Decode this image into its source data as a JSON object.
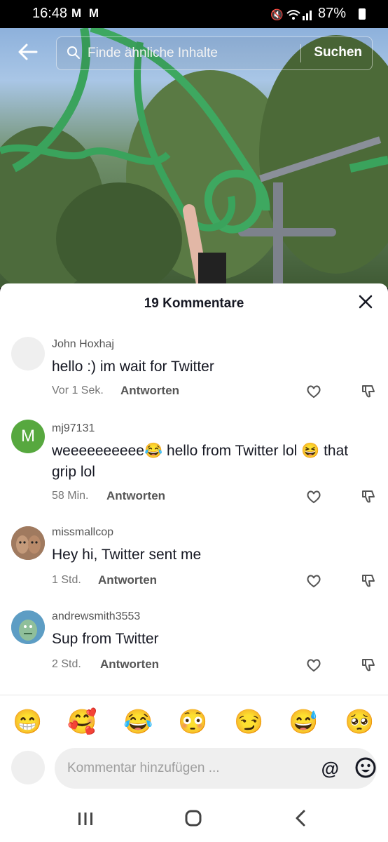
{
  "status_bar": {
    "time": "16:48",
    "left_icons_text": "M M",
    "battery": "87%"
  },
  "search": {
    "placeholder": "Finde ähnliche Inhalte",
    "button": "Suchen"
  },
  "comments": {
    "title": "19 Kommentare",
    "items": [
      {
        "user": "John Hoxhaj",
        "text": "hello :) im wait for Twitter",
        "time": "Vor 1 Sek.",
        "reply": "Antworten",
        "avatar_letter": ""
      },
      {
        "user": "mj97131",
        "text": "weeeeeeeeee😂 hello from Twitter lol 😆 that grip lol",
        "time": "58 Min.",
        "reply": "Antworten",
        "avatar_letter": "M"
      },
      {
        "user": "missmallcop",
        "text": "Hey hi, Twitter sent me",
        "time": "1 Std.",
        "reply": "Antworten",
        "avatar_letter": ""
      },
      {
        "user": "andrewsmith3553",
        "text": "Sup from Twitter",
        "time": "2 Std.",
        "reply": "Antworten",
        "avatar_letter": ""
      }
    ]
  },
  "emoji_bar": [
    "😁",
    "🥰",
    "😂",
    "😳",
    "😏",
    "😅",
    "🥺"
  ],
  "composer": {
    "placeholder": "Kommentar hinzufügen ...",
    "mention": "@"
  },
  "colors": {
    "avatar_green": "#57a83f",
    "text_primary": "#161823"
  }
}
